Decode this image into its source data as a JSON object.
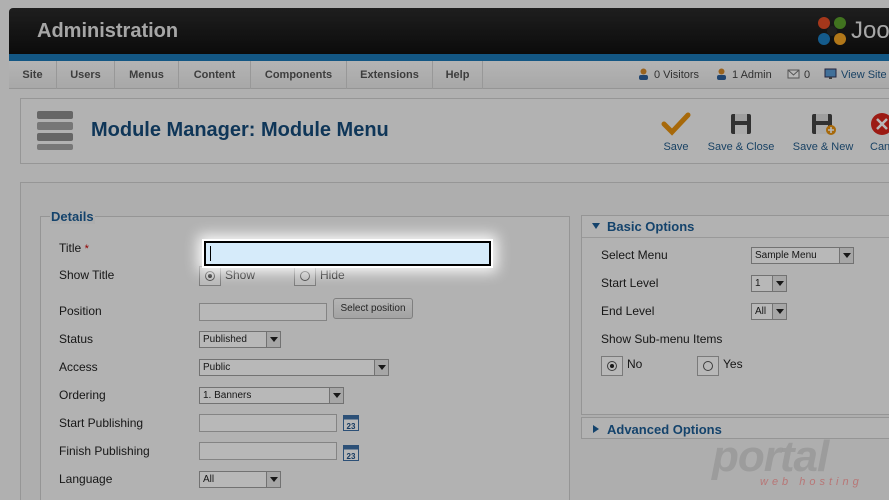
{
  "header": {
    "title": "Administration",
    "logo_text": "Joo"
  },
  "menu": [
    "Site",
    "Users",
    "Menus",
    "Content",
    "Components",
    "Extensions",
    "Help"
  ],
  "status": {
    "visitors": "0 Visitors",
    "admins": "1 Admin",
    "messages": "0",
    "view_site": "View Site"
  },
  "toolbar": {
    "page_title": "Module Manager: Module Menu",
    "save": "Save",
    "save_close": "Save & Close",
    "save_new": "Save & New",
    "cancel": "Can"
  },
  "details": {
    "legend": "Details",
    "title_label": "Title",
    "required_mark": "*",
    "title_value": "",
    "show_title_label": "Show Title",
    "show_option": "Show",
    "hide_option": "Hide",
    "position_label": "Position",
    "position_value": "",
    "select_position": "Select position",
    "status_label": "Status",
    "status_value": "Published",
    "access_label": "Access",
    "access_value": "Public",
    "ordering_label": "Ordering",
    "ordering_value": "1. Banners",
    "start_publishing_label": "Start Publishing",
    "finish_publishing_label": "Finish Publishing",
    "language_label": "Language",
    "language_value": "All",
    "calendar_icon_text": "23"
  },
  "basic_options": {
    "heading": "Basic Options",
    "select_menu_label": "Select Menu",
    "select_menu_value": "Sample Menu",
    "start_level_label": "Start Level",
    "start_level_value": "1",
    "end_level_label": "End Level",
    "end_level_value": "All",
    "show_submenu_label": "Show Sub-menu Items",
    "no_option": "No",
    "yes_option": "Yes"
  },
  "advanced_options": {
    "heading": "Advanced Options"
  },
  "watermark": {
    "brand": "portal",
    "tagline": "web hosting"
  },
  "colors": {
    "accent": "#1b79b8",
    "title": "#164c7b",
    "header": "#1a1a1a"
  }
}
